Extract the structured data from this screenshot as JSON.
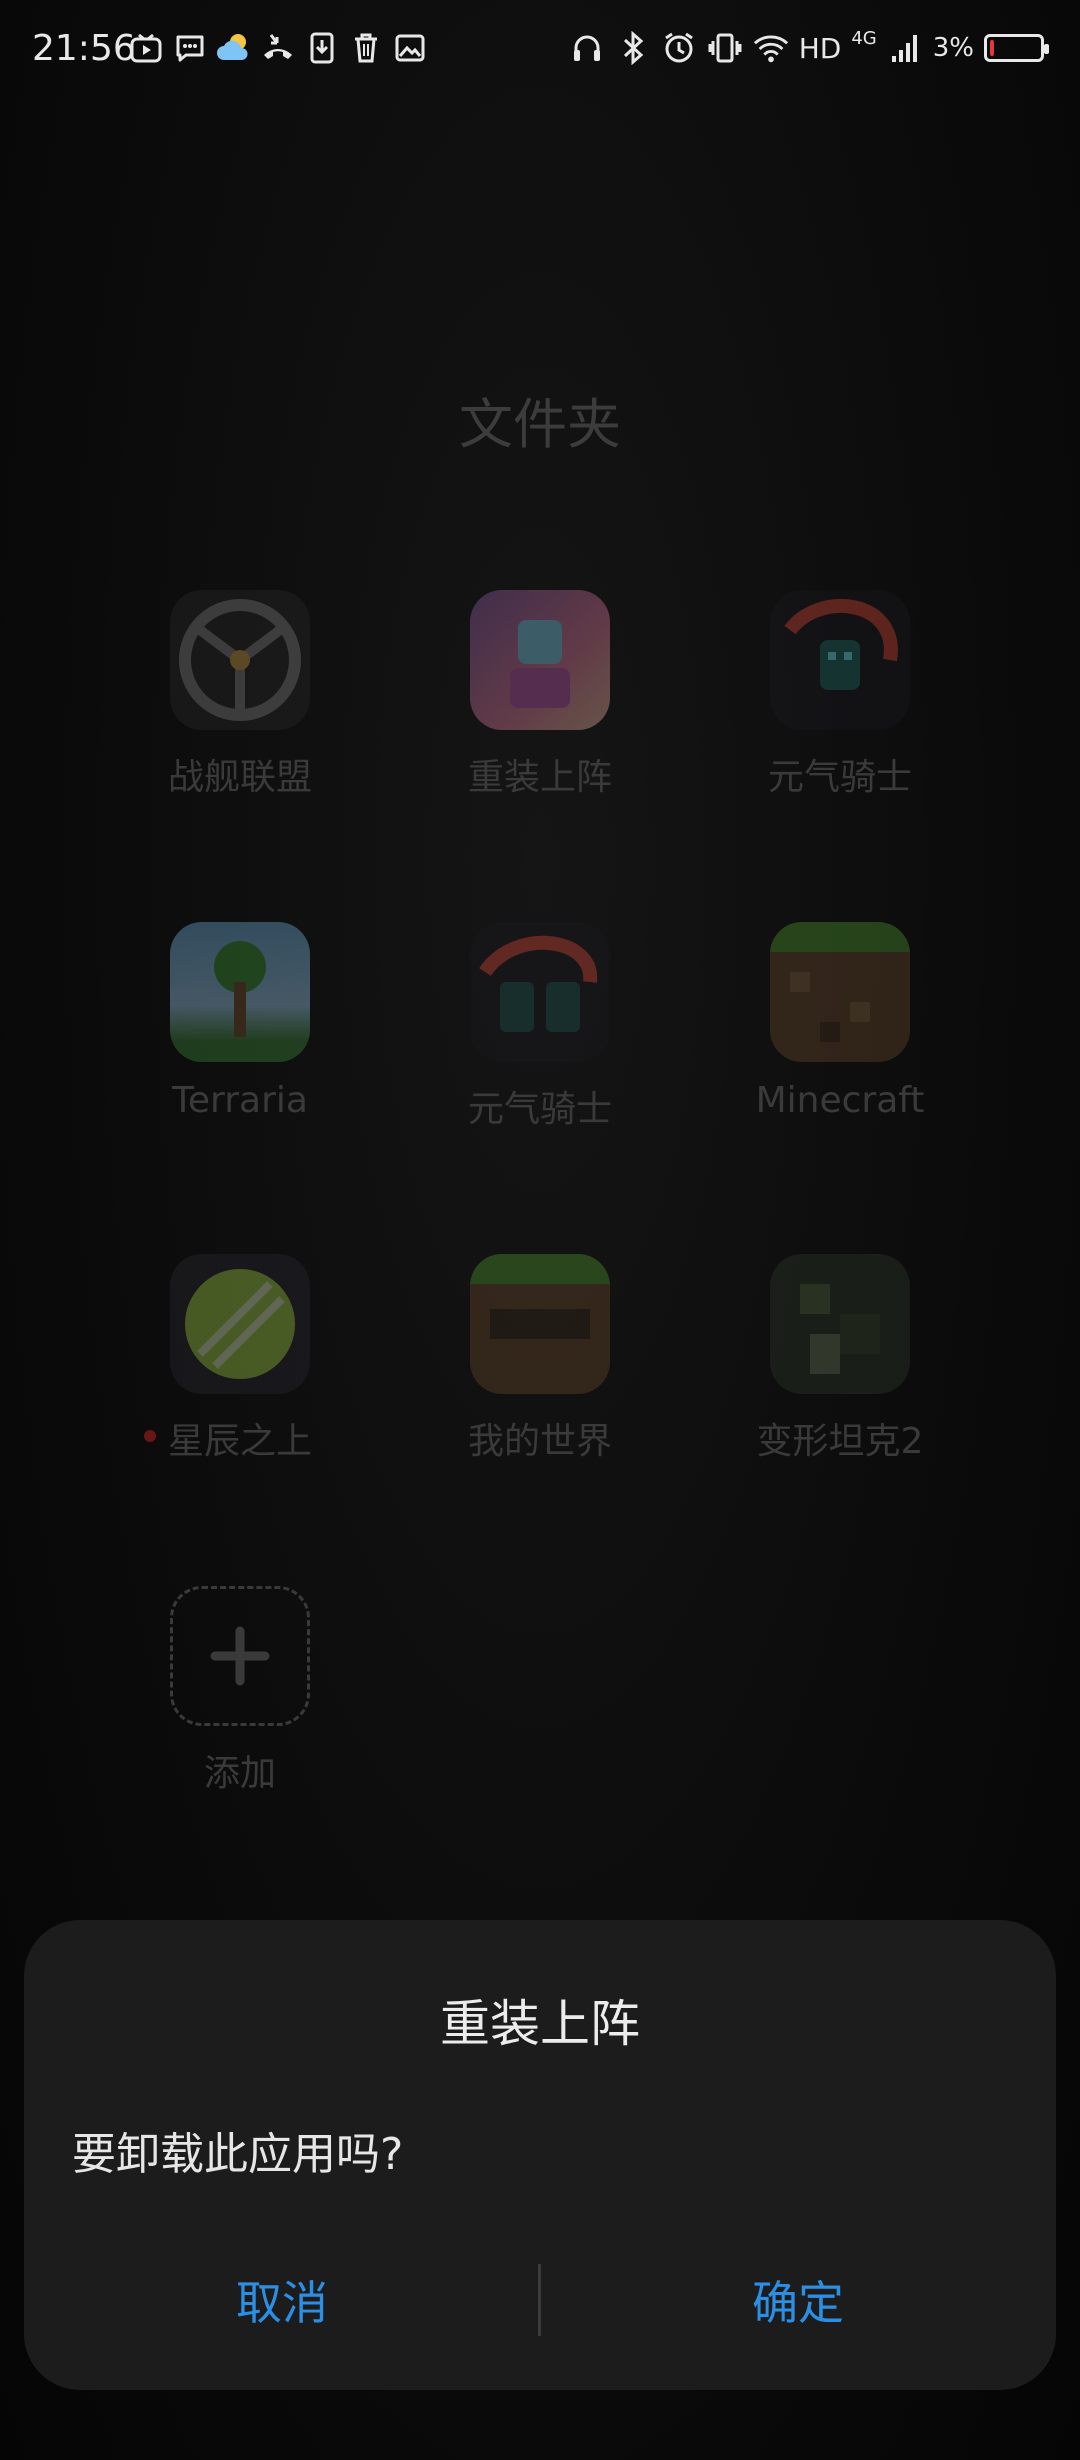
{
  "status_bar": {
    "time": "21:56",
    "network": "HD",
    "network_type": "4G",
    "battery_percent_text": "3%",
    "battery_level": 0.03,
    "left_icons": [
      "video-app-icon",
      "chat-bubble-icon",
      "weather-cloud-icon",
      "missed-call-icon",
      "download-icon",
      "trash-icon",
      "gallery-icon"
    ],
    "right_icons": [
      "headphones-icon",
      "bluetooth-icon",
      "alarm-icon",
      "vibrate-icon",
      "wifi-icon",
      "signal-icon"
    ]
  },
  "folder": {
    "title": "文件夹",
    "apps": [
      {
        "name": "战舰联盟",
        "icon": "warship-alliance-icon"
      },
      {
        "name": "重装上阵",
        "icon": "reassembly-icon"
      },
      {
        "name": "元气骑士",
        "icon": "soul-knight-icon"
      },
      {
        "name": "Terraria",
        "icon": "terraria-icon"
      },
      {
        "name": "元气骑士",
        "icon": "soul-knight-icon"
      },
      {
        "name": "Minecraft",
        "icon": "minecraft-icon"
      },
      {
        "name": "星辰之上",
        "icon": "above-the-stars-icon",
        "has_dot": true
      },
      {
        "name": "我的世界",
        "icon": "my-world-icon"
      },
      {
        "name": "变形坦克2",
        "icon": "transform-tank-icon"
      },
      {
        "name": "添加",
        "icon": "plus-icon"
      }
    ]
  },
  "dialog": {
    "title": "重装上阵",
    "message": "要卸载此应用吗?",
    "cancel_label": "取消",
    "confirm_label": "确定",
    "accent_color": "#2b8fe6"
  }
}
